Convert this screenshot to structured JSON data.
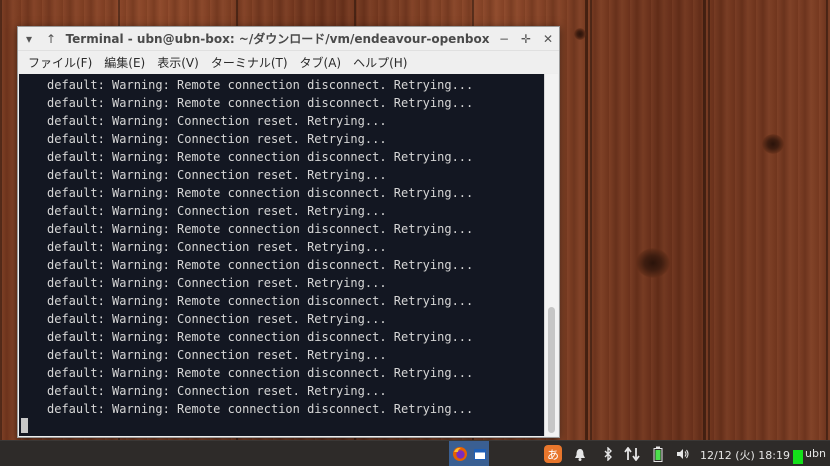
{
  "window": {
    "title": "Terminal - ubn@ubn-box: ~/ダウンロード/vm/endeavour-openbox",
    "menu": [
      "ファイル(F)",
      "編集(E)",
      "表示(V)",
      "ターミナル(T)",
      "タブ(A)",
      "ヘルプ(H)"
    ]
  },
  "terminal": {
    "lines": [
      "default: Warning: Remote connection disconnect. Retrying...",
      "default: Warning: Remote connection disconnect. Retrying...",
      "default: Warning: Connection reset. Retrying...",
      "default: Warning: Connection reset. Retrying...",
      "default: Warning: Remote connection disconnect. Retrying...",
      "default: Warning: Connection reset. Retrying...",
      "default: Warning: Remote connection disconnect. Retrying...",
      "default: Warning: Connection reset. Retrying...",
      "default: Warning: Remote connection disconnect. Retrying...",
      "default: Warning: Connection reset. Retrying...",
      "default: Warning: Remote connection disconnect. Retrying...",
      "default: Warning: Connection reset. Retrying...",
      "default: Warning: Remote connection disconnect. Retrying...",
      "default: Warning: Connection reset. Retrying...",
      "default: Warning: Remote connection disconnect. Retrying...",
      "default: Warning: Connection reset. Retrying...",
      "default: Warning: Remote connection disconnect. Retrying...",
      "default: Warning: Connection reset. Retrying...",
      "default: Warning: Remote connection disconnect. Retrying..."
    ]
  },
  "taskbar": {
    "input_method": "あ",
    "clock": "12/12 (火) 18:19",
    "user": "ubn",
    "icons": [
      "firefox-icon",
      "terminal-window-icon",
      "input-method-icon",
      "notification-bell-icon",
      "bluetooth-icon",
      "network-icon",
      "battery-icon",
      "volume-icon"
    ]
  },
  "colors": {
    "terminal_bg": "#131722",
    "terminal_fg": "#d6d6d6",
    "taskbar_bg": "#2e2b29",
    "input_method_bg": "#e8762c",
    "indicator_green": "#14e01a"
  }
}
